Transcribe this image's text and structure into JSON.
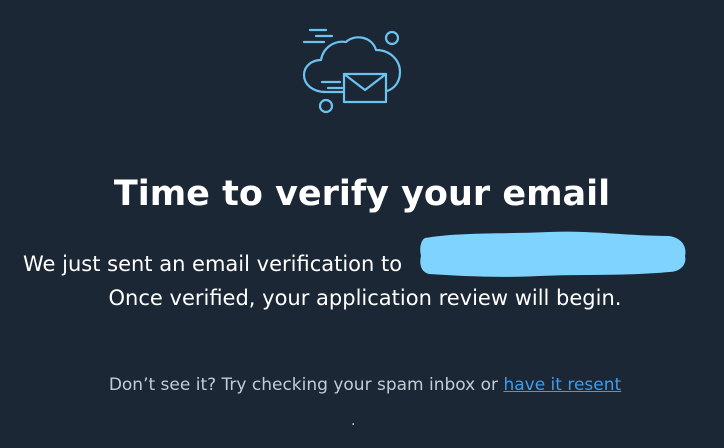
{
  "icon": "cloud-email-icon",
  "title": "Time to verify your email",
  "message_line1_prefix": "We just sent an email verification to",
  "message_line2": "Once verified, your application review will begin.",
  "hint_prefix": "Don’t see it? Try checking your spam inbox or",
  "resend_link_label": "have it resent",
  "footer_dot": ".",
  "colors": {
    "background": "#1b2735",
    "icon_stroke": "#6cc3f0",
    "redaction": "#7fd4ff",
    "link": "#3d9cf0",
    "hint_text": "#c4ccd6"
  }
}
